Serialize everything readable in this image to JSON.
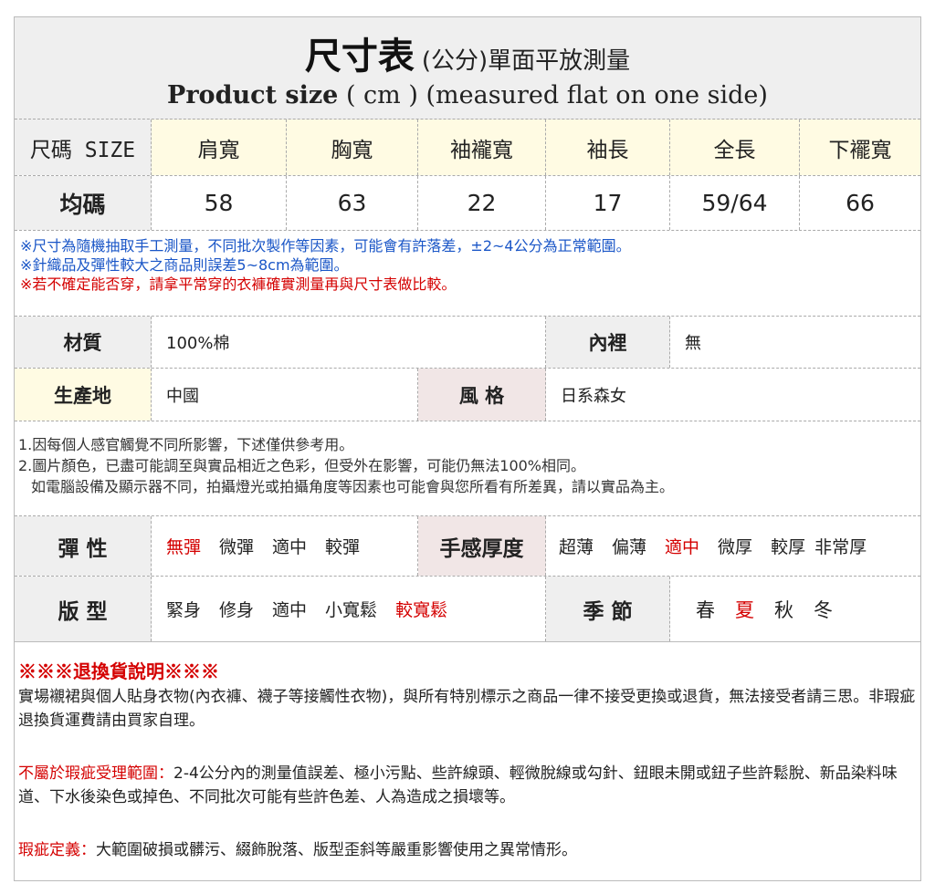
{
  "header": {
    "title_main": "尺寸表",
    "title_sub": "(公分)單面平放測量",
    "title_en_bold": "Product size",
    "title_en_rest": " ( cm ) (measured flat on one side)"
  },
  "size_table": {
    "headers": [
      "尺碼 SIZE",
      "肩寬",
      "胸寬",
      "袖襱寬",
      "袖長",
      "全長",
      "下襬寬"
    ],
    "row": [
      "均碼",
      "58",
      "63",
      "22",
      "17",
      "59/64",
      "66"
    ]
  },
  "notes_top": [
    "※尺寸為隨機抽取手工測量，不同批次製作等因素，可能會有許落差，±2~4公分為正常範圍。",
    "※針織品及彈性較大之商品則誤差5~8cm為範圍。",
    "※若不確定能否穿，請拿平常穿的衣褲確實測量再與尺寸表做比較。"
  ],
  "info": {
    "material_label": "材質",
    "material_value": "100%棉",
    "lining_label": "內裡",
    "lining_value": "無",
    "origin_label": "生產地",
    "origin_value": "中國",
    "style_label": "風 格",
    "style_value": "日系森女"
  },
  "notes_mid": [
    "1.因每個人感官觸覺不同所影響，下述僅供參考用。",
    "2.圖片顏色，已盡可能調至與實品相近之色彩，但受外在影響，可能仍無法100%相同。",
    "如電腦設備及顯示器不同，拍攝燈光或拍攝角度等因素也可能會與您所看有所差異，請以實品為主。"
  ],
  "attributes": {
    "elasticity_label": "彈 性",
    "elasticity_options": [
      "無彈",
      "微彈",
      "適中",
      "較彈"
    ],
    "elasticity_selected": "無彈",
    "thickness_label": "手感厚度",
    "thickness_options": [
      "超薄",
      "偏薄",
      "適中",
      "微厚",
      "較厚",
      "非常厚"
    ],
    "thickness_selected": "適中",
    "fit_label": "版 型",
    "fit_options": [
      "緊身",
      "修身",
      "適中",
      "小寬鬆",
      "較寬鬆"
    ],
    "fit_selected": "較寬鬆",
    "season_label": "季 節",
    "season_options": [
      "春",
      "夏",
      "秋",
      "冬"
    ],
    "season_selected": "夏"
  },
  "returns": {
    "title": "※※※退換貨說明※※※",
    "para1": "實場襯裙與個人貼身衣物(內衣褲、襪子等接觸性衣物)，與所有特別標示之商品一律不接受更換或退貨，無法接受者請三思。非瑕疵退換貨運費請由買家自理。",
    "para2_label": "不屬於瑕疵受理範圍：",
    "para2_text": "2-4公分內的測量值誤差、極小污點、些許線頭、輕微脫線或勾針、鈕眼未開或鈕子些許鬆脫、新品染料味道、下水後染色或掉色、不同批次可能有些許色差、人為造成之損壞等。",
    "para3_label": "瑕疵定義：",
    "para3_text": "大範圍破損或髒污、綴飾脫落、版型歪斜等嚴重影響使用之異常情形。"
  },
  "colors": {
    "accent_red": "#d40000",
    "note_blue": "#1a56c7",
    "header_gray": "#efefef",
    "cream": "#fffbe3",
    "pink": "#f1e6e6"
  }
}
